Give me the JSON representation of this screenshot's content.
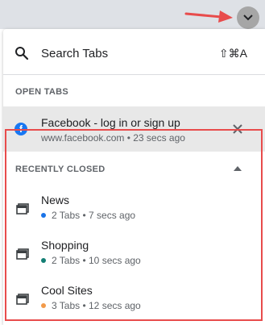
{
  "search": {
    "label": "Search Tabs",
    "shortcut": "⇧⌘A"
  },
  "open_tabs": {
    "title": "OPEN TABS",
    "items": [
      {
        "title": "Facebook - log in or sign up",
        "subtitle": "www.facebook.com • 23 secs ago",
        "icon_letter": "f"
      }
    ]
  },
  "recently_closed": {
    "title": "RECENTLY CLOSED",
    "groups": [
      {
        "title": "News",
        "subtitle": "2 Tabs • 7 secs ago",
        "color": "#1a73e8"
      },
      {
        "title": "Shopping",
        "subtitle": "2 Tabs • 10 secs ago",
        "color": "#137e74"
      },
      {
        "title": "Cool Sites",
        "subtitle": "3 Tabs • 12 secs ago",
        "color": "#f29a4a"
      }
    ]
  },
  "colors": {
    "highlight": "#e84c4c",
    "facebook": "#1877f2"
  }
}
